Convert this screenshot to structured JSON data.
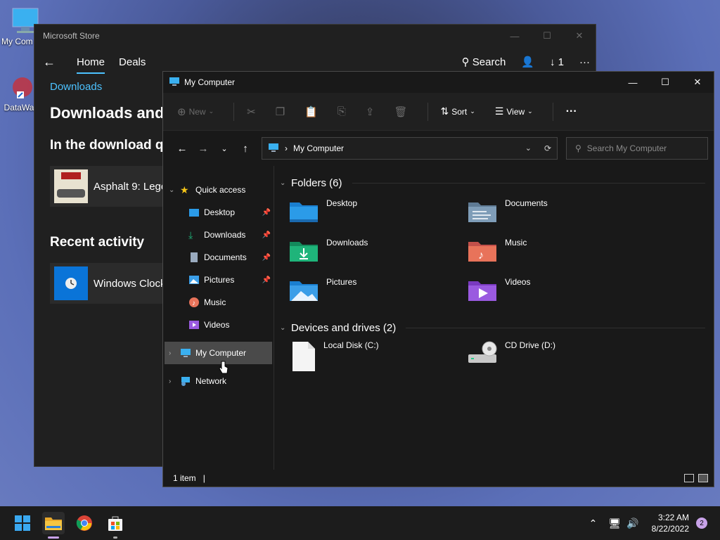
{
  "desktop": {
    "icons": [
      {
        "label": "My Com",
        "icon": "monitor-icon"
      },
      {
        "label": "DataWac",
        "icon": "app-shortcut-icon"
      }
    ]
  },
  "store": {
    "title": "Microsoft Store",
    "nav": {
      "home": "Home",
      "deals": "Deals",
      "search": "Search",
      "downloads_count": "1"
    },
    "breadcrumb": "Downloads",
    "heading": "Downloads and",
    "download_section": "In the download q",
    "download_item": "Asphalt 9: Lege",
    "recent_heading": "Recent activity",
    "recent_item": "Windows Clock"
  },
  "explorer": {
    "title": "My Computer",
    "toolbar": {
      "new": "New",
      "sort": "Sort",
      "view": "View"
    },
    "address": "My Computer",
    "search_placeholder": "Search My Computer",
    "sidebar": [
      {
        "label": "Quick access",
        "icon": "star-icon",
        "pinned": false,
        "chevron": "v",
        "indent": 0
      },
      {
        "label": "Desktop",
        "icon": "desktop-folder-icon",
        "pinned": true,
        "indent": 1
      },
      {
        "label": "Downloads",
        "icon": "download-icon",
        "pinned": true,
        "indent": 1
      },
      {
        "label": "Documents",
        "icon": "document-icon",
        "pinned": true,
        "indent": 1
      },
      {
        "label": "Pictures",
        "icon": "pictures-icon",
        "pinned": true,
        "indent": 1
      },
      {
        "label": "Music",
        "icon": "music-icon",
        "pinned": false,
        "indent": 1
      },
      {
        "label": "Videos",
        "icon": "videos-icon",
        "pinned": false,
        "indent": 1
      },
      {
        "label": "My Computer",
        "icon": "computer-icon",
        "pinned": false,
        "chevron": ">",
        "indent": 0,
        "selected": true
      },
      {
        "label": "Network",
        "icon": "network-icon",
        "pinned": false,
        "chevron": ">",
        "indent": 0
      }
    ],
    "folders_group": "Folders (6)",
    "folders": [
      {
        "label": "Desktop",
        "icon": "desktop-folder-icon",
        "color": "#2b9be8"
      },
      {
        "label": "Documents",
        "icon": "documents-folder-icon",
        "color": "#7f9db8"
      },
      {
        "label": "Downloads",
        "icon": "downloads-folder-icon",
        "color": "#1fb47a"
      },
      {
        "label": "Music",
        "icon": "music-folder-icon",
        "color": "#e8735a"
      },
      {
        "label": "Pictures",
        "icon": "pictures-folder-icon",
        "color": "#3a9ee8"
      },
      {
        "label": "Videos",
        "icon": "videos-folder-icon",
        "color": "#9a5ae0"
      }
    ],
    "drives_group": "Devices and drives (2)",
    "drives": [
      {
        "label": "Local Disk (C:)",
        "icon": "disk-icon"
      },
      {
        "label": "CD Drive (D:)",
        "icon": "cd-drive-icon"
      }
    ],
    "status": "1 item"
  },
  "taskbar": {
    "time": "3:22 AM",
    "date": "8/22/2022",
    "notification_count": "2"
  }
}
